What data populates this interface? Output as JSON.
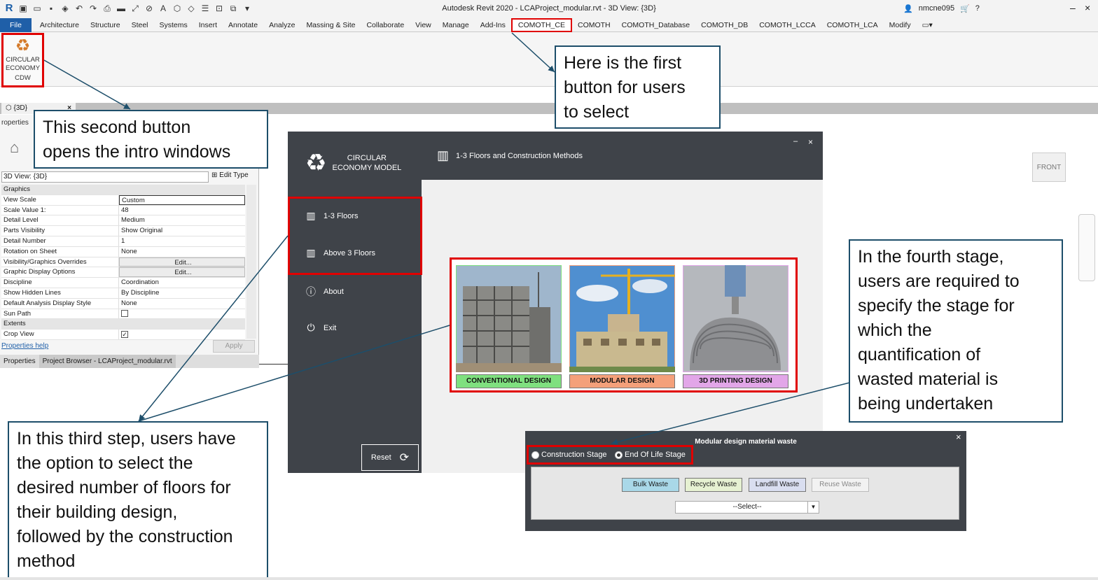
{
  "titlebar": {
    "app_logo": "R",
    "window_title": "Autodesk Revit 2020 - LCAProject_modular.rvt - 3D View: {3D}",
    "username": "nmcne095",
    "minimize_icon": "minimize-icon",
    "close_icon": "close-icon"
  },
  "ribbon": {
    "tabs": [
      "File",
      "Architecture",
      "Structure",
      "Steel",
      "Systems",
      "Insert",
      "Annotate",
      "Analyze",
      "Massing & Site",
      "Collaborate",
      "View",
      "Manage",
      "Add-Ins",
      "COMOTH_CE",
      "COMOTH",
      "COMOTH_Database",
      "COMOTH_DB",
      "COMOTH_LCCA",
      "COMOTH_LCA",
      "Modify"
    ],
    "active_tab": "COMOTH_CE",
    "ce_button": {
      "line1": "CIRCULAR",
      "line2": "ECONOMY",
      "line3": "CDW"
    }
  },
  "view_tab": {
    "label": "{3D}",
    "close": "×"
  },
  "properties": {
    "title": "roperties",
    "type_selector": "3D View: {3D}",
    "edit_type": "Edit Type",
    "rows": [
      {
        "k": "Graphics",
        "v": "",
        "section": true
      },
      {
        "k": "View Scale",
        "v": "Custom",
        "boxed": true
      },
      {
        "k": "Scale Value    1:",
        "v": "48"
      },
      {
        "k": "Detail Level",
        "v": "Medium"
      },
      {
        "k": "Parts Visibility",
        "v": "Show Original"
      },
      {
        "k": "Detail Number",
        "v": "1"
      },
      {
        "k": "Rotation on Sheet",
        "v": "None"
      },
      {
        "k": "Visibility/Graphics Overrides",
        "v": "Edit...",
        "btn": true
      },
      {
        "k": "Graphic Display Options",
        "v": "Edit...",
        "btn": true
      },
      {
        "k": "Discipline",
        "v": "Coordination"
      },
      {
        "k": "Show Hidden Lines",
        "v": "By Discipline"
      },
      {
        "k": "Default Analysis Display Style",
        "v": "None"
      },
      {
        "k": "Sun Path",
        "v": "",
        "check": false
      },
      {
        "k": "Extents",
        "v": "",
        "section": true
      },
      {
        "k": "Crop View",
        "v": "",
        "check": true
      }
    ],
    "help_link": "Properties help",
    "apply": "Apply",
    "bottom_tabs": [
      "Properties",
      "Project Browser - LCAProject_modular.rvt"
    ]
  },
  "view_cube": {
    "label": "FRONT"
  },
  "app": {
    "logo_line1": "CIRCULAR",
    "logo_line2": "ECONOMY MODEL",
    "header_title": "1-3 Floors and Construction Methods",
    "minimize": "–",
    "close": "×",
    "sidebar": [
      {
        "label": "1-3 Floors",
        "icon": "building-icon"
      },
      {
        "label": "Above 3 Floors",
        "icon": "building-icon"
      },
      {
        "label": "About",
        "icon": "info-icon"
      },
      {
        "label": "Exit",
        "icon": "power-icon"
      }
    ],
    "reset": "Reset",
    "designs": [
      {
        "label": "CONVENTIONAL DESIGN",
        "color": "#7fe07f"
      },
      {
        "label": "MODULAR DESIGN",
        "color": "#f4a07a"
      },
      {
        "label": "3D PRINTING DESIGN",
        "color": "#e2a6e8"
      }
    ]
  },
  "waste_dialog": {
    "title": "Modular design material waste",
    "close": "×",
    "radio_construction": "Construction Stage",
    "radio_eol": "End Of Life Stage",
    "selected_stage": "End Of Life Stage",
    "buttons": [
      {
        "label": "Bulk Waste",
        "color": "#a9d8e8"
      },
      {
        "label": "Recycle Waste",
        "color": "#e6f1d2"
      },
      {
        "label": "Landfill Waste",
        "color": "#d9def0"
      },
      {
        "label": "Reuse Waste",
        "color": "#f2f2f2"
      }
    ],
    "select_placeholder": "--Select--"
  },
  "callouts": {
    "first": [
      "Here is the first",
      "button for users",
      "to select"
    ],
    "second": [
      "This second button",
      "opens the intro windows"
    ],
    "third": [
      "In this third step, users have",
      "the option to select the",
      "desired number of floors for",
      "their building design,",
      "followed by the construction",
      "method"
    ],
    "fourth": [
      "In the fourth stage,",
      "users are required to",
      "specify the stage for",
      "which the",
      "quantification of",
      "wasted material is",
      "being undertaken"
    ]
  },
  "colors": {
    "accent_red": "#e00000",
    "app_dark": "#3f4349",
    "callout_border": "#1d4e6a",
    "file_tab": "#1f5fa8"
  }
}
